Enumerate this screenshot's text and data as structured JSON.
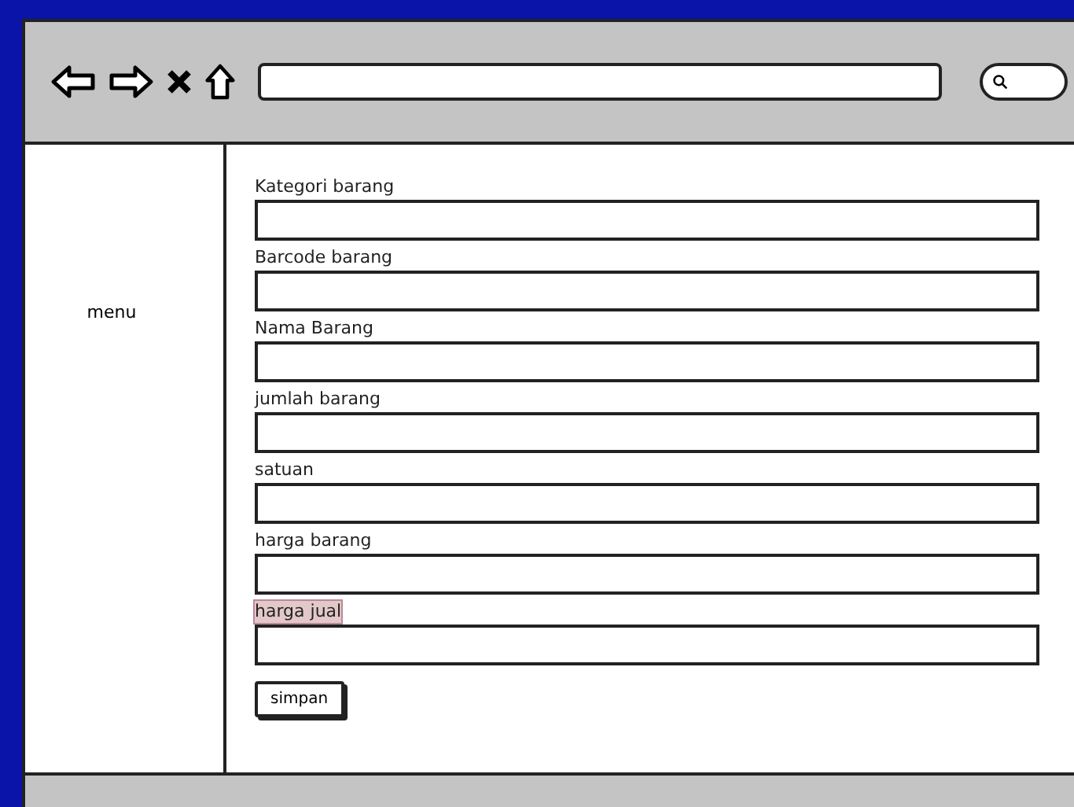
{
  "sidebar": {
    "label": "menu"
  },
  "form": {
    "fields": [
      {
        "label": "Kategori barang",
        "highlighted": false
      },
      {
        "label": "Barcode barang",
        "highlighted": false
      },
      {
        "label": "Nama Barang",
        "highlighted": false
      },
      {
        "label": "jumlah barang",
        "highlighted": false
      },
      {
        "label": "satuan",
        "highlighted": false
      },
      {
        "label": "harga barang",
        "highlighted": false
      },
      {
        "label": "harga jual",
        "highlighted": true
      }
    ],
    "submit": "simpan"
  }
}
